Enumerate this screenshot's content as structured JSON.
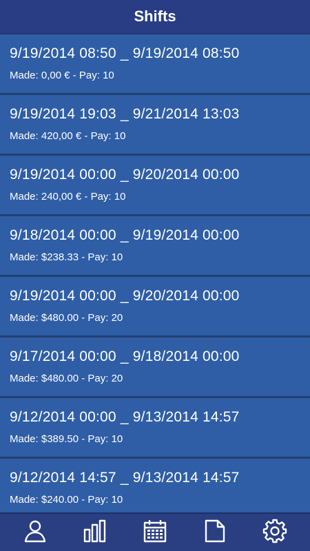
{
  "header": {
    "title": "Shifts"
  },
  "shifts": [
    {
      "range": "9/19/2014 08:50 _ 9/19/2014 08:50",
      "meta": "Made: 0,00 € - Pay: 10"
    },
    {
      "range": "9/19/2014 19:03 _ 9/21/2014 13:03",
      "meta": "Made: 420,00 € - Pay: 10"
    },
    {
      "range": "9/19/2014 00:00 _ 9/20/2014 00:00",
      "meta": "Made: 240,00 € - Pay: 10"
    },
    {
      "range": "9/18/2014 00:00 _ 9/19/2014 00:00",
      "meta": "Made: $238.33 - Pay: 10"
    },
    {
      "range": "9/19/2014 00:00 _ 9/20/2014 00:00",
      "meta": "Made: $480.00 - Pay: 20"
    },
    {
      "range": "9/17/2014 00:00 _ 9/18/2014 00:00",
      "meta": "Made: $480.00 - Pay: 20"
    },
    {
      "range": "9/12/2014 00:00 _ 9/13/2014 14:57",
      "meta": "Made: $389.50 - Pay: 10"
    },
    {
      "range": "9/12/2014 14:57 _ 9/13/2014 14:57",
      "meta": "Made: $240.00 - Pay: 10"
    }
  ],
  "tabbar": {
    "tabs": [
      {
        "icon": "person-icon"
      },
      {
        "icon": "bar-chart-icon"
      },
      {
        "icon": "calendar-icon"
      },
      {
        "icon": "document-icon"
      },
      {
        "icon": "gear-icon"
      }
    ]
  },
  "colors": {
    "header": "#283d84",
    "row": "#2f5ea6",
    "text": "#ffffff"
  }
}
